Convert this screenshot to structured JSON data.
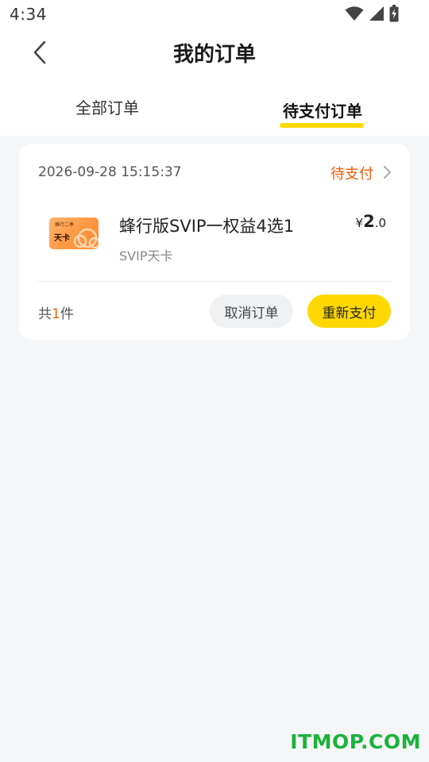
{
  "status_bar": {
    "time": "4:34",
    "icons": [
      "wifi-icon",
      "signal-icon",
      "battery-charging-icon"
    ]
  },
  "header": {
    "back_icon": "chevron-left-icon",
    "title": "我的订单"
  },
  "tabs": [
    {
      "label": "全部订单",
      "selected": false
    },
    {
      "label": "待支付订单",
      "selected": true
    }
  ],
  "orders": [
    {
      "time": "2026-09-28 15:15:37",
      "status": "待支付",
      "product": {
        "name": "蜂行版SVIP一权益4选1",
        "sub": "SVIP天卡",
        "thumb_text": "天卡"
      },
      "price": {
        "symbol": "¥",
        "integer": "2",
        "decimal": ".0"
      },
      "count": {
        "prefix": "共",
        "value": "1",
        "suffix": "件"
      },
      "actions": {
        "cancel": "取消订单",
        "repay": "重新支付"
      }
    }
  ],
  "colors": {
    "accent_yellow": "#ffd800",
    "status_orange": "#f25c05",
    "background": "#f5f6f8",
    "watermark_green": "#1bb23c"
  },
  "watermark": "ITMOP.COM"
}
